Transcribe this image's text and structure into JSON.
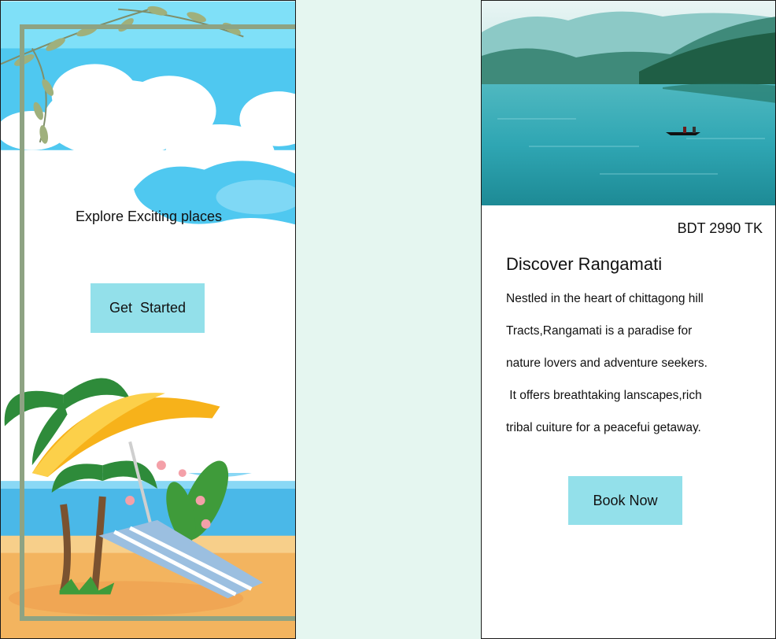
{
  "onboarding": {
    "tagline": "Explore Exciting places",
    "cta_label": "Get  Started"
  },
  "details": {
    "price": "BDT 2990 TK",
    "title": "Discover Rangamati",
    "description_lines": [
      "Nestled in the heart of chittagong hill",
      "Tracts,Rangamati is a paradise for",
      "nature lovers and adventure seekers.",
      " It offers breathtaking lanscapes,rich",
      "tribal cuiture for a peacefui getaway."
    ],
    "cta_label": "Book Now"
  },
  "colors": {
    "canvas_bg": "#e5f6f0",
    "button_bg": "#93e0ea",
    "frame_border": "#8ea383",
    "sky": "#41c2ee",
    "lake": "#2fa6b3"
  }
}
